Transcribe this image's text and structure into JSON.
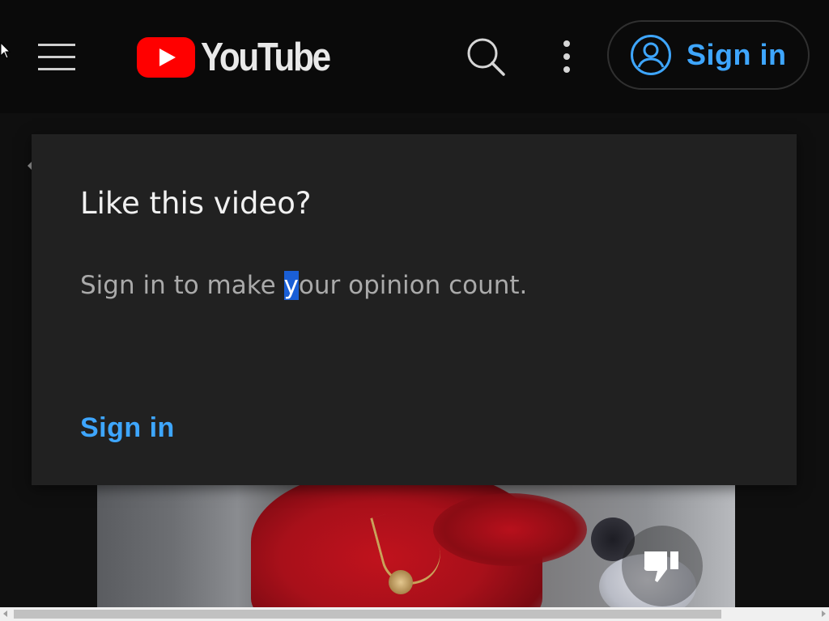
{
  "header": {
    "logo_text": "YouTube",
    "signin_label": "Sign in",
    "icons": {
      "menu": "hamburger-menu-icon",
      "logo": "youtube-play-icon",
      "search": "search-icon",
      "more": "more-vertical-icon",
      "account": "account-circle-icon"
    }
  },
  "dialog": {
    "title": "Like this video?",
    "body_before": "Sign in to make ",
    "body_selected": "y",
    "body_after": "our opinion count.",
    "signin_label": "Sign in"
  },
  "video": {
    "icons": {
      "dislike": "thumb-down-icon"
    }
  },
  "colors": {
    "accent": "#3ea6ff",
    "brand_red": "#ff0000",
    "dialog_bg": "#212121",
    "page_bg": "#0f0f0f"
  }
}
